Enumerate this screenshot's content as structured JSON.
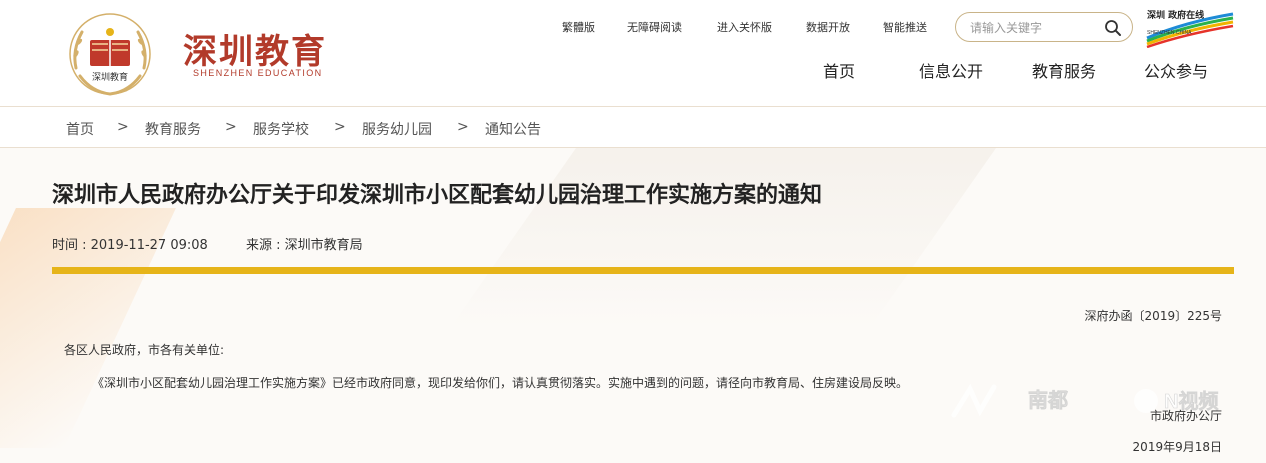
{
  "header": {
    "brand_cn": "深圳教育",
    "brand_en": "SHENZHEN EDUCATION",
    "logo_text": "深圳教育",
    "top_links": [
      "繁體版",
      "无障碍阅读",
      "进入关怀版",
      "数据开放",
      "智能推送"
    ],
    "search_placeholder": "请输入关键字",
    "nav": [
      "首页",
      "信息公开",
      "教育服务",
      "公众参与"
    ],
    "sz_logo_text": "深圳 政府在线",
    "sz_logo_en": "SHENZHEN CHINA"
  },
  "breadcrumb": {
    "items": [
      "首页",
      "教育服务",
      "服务学校",
      "服务幼儿园",
      "通知公告"
    ],
    "separator": ">"
  },
  "article": {
    "title": "深圳市人民政府办公厅关于印发深圳市小区配套幼儿园治理工作实施方案的通知",
    "time": "时间 : 2019-11-27 09:08",
    "source": "来源 : 深圳市教育局",
    "doc_no": "深府办函〔2019〕225号",
    "greeting": "各区人民政府，市各有关单位:",
    "body": "《深圳市小区配套幼儿园治理工作实施方案》已经市政府同意，现印发给你们，请认真贯彻落实。实施中遇到的问题，请径向市教育局、住房建设局反映。",
    "signer": "市政府办公厅",
    "date": "2019年9月18日"
  },
  "watermark": {
    "text_left": "南都",
    "text_right": "N视频"
  },
  "colors": {
    "accent_gold": "#e6b419",
    "brand_red": "#b23a2a",
    "search_border": "#c9b489"
  }
}
